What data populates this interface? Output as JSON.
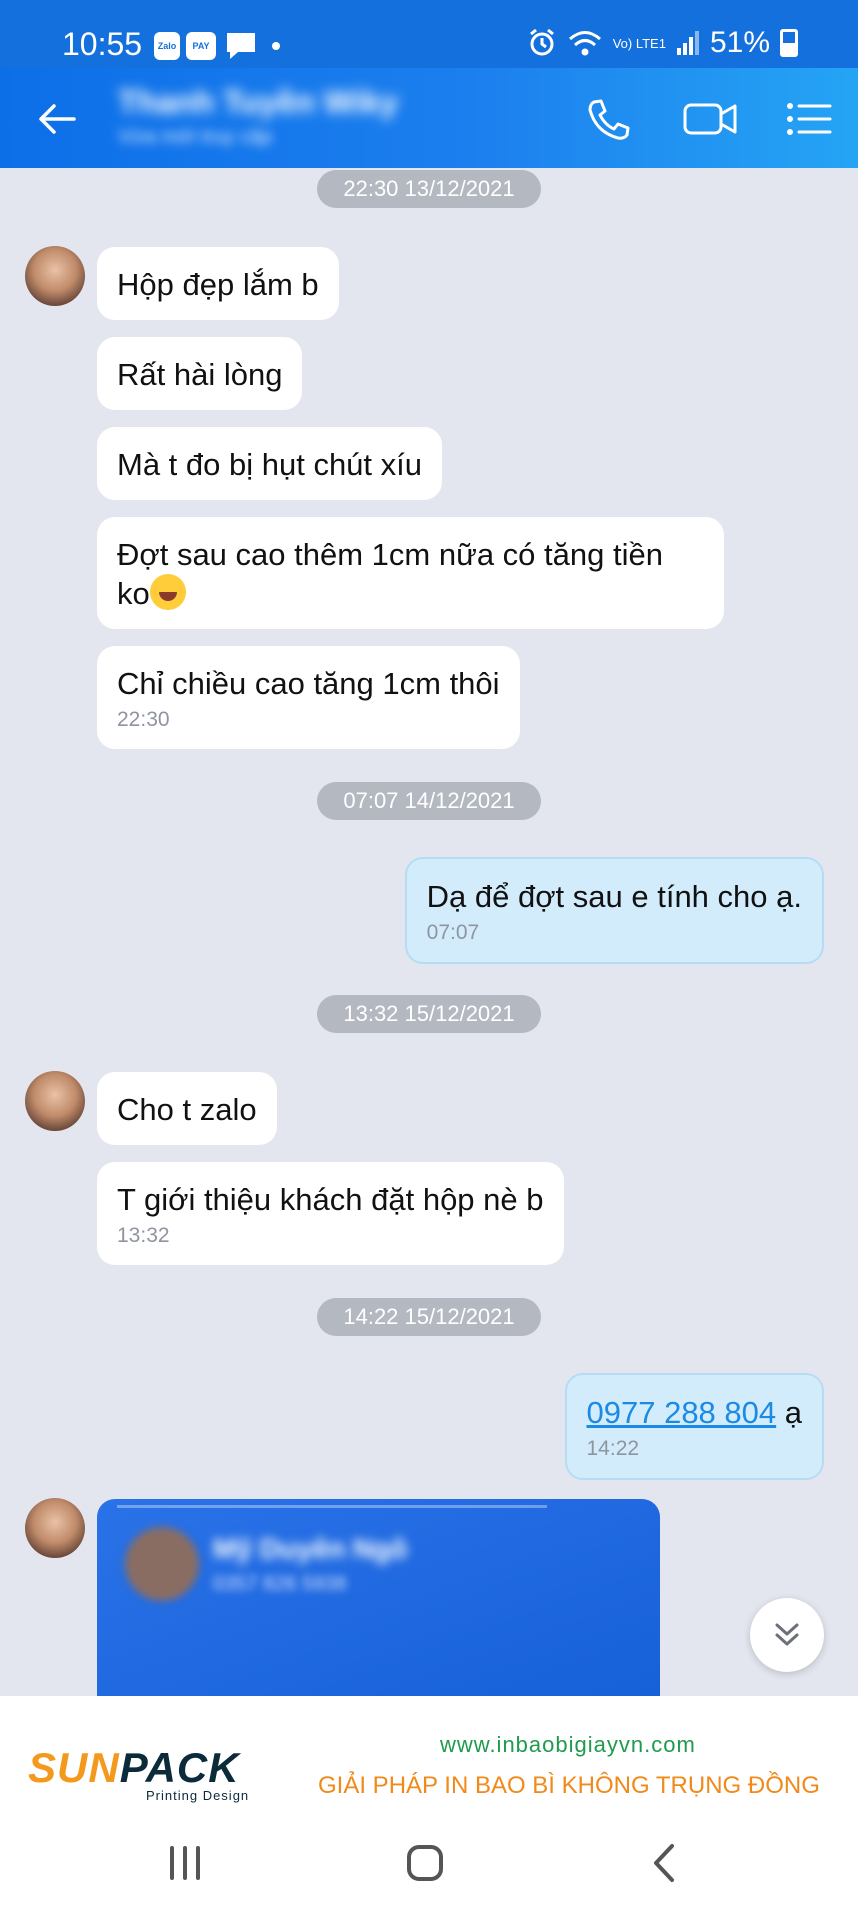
{
  "status_bar": {
    "time": "10:55",
    "apps": [
      "Zalo",
      "ZaloPay"
    ],
    "network_label": "Vo) LTE1",
    "battery": "51%"
  },
  "header": {
    "contact_name": "Thanh Tuyền Wiky",
    "contact_status": "Vừa mới truy cập",
    "icons": [
      "back-arrow-icon",
      "phone-icon",
      "video-call-icon",
      "menu-list-icon"
    ]
  },
  "messages": {
    "date_1": "22:30 13/12/2021",
    "m1": "Hộp đẹp lắm b",
    "m2": "Rất hài lòng",
    "m3": "Mà t đo bị hụt chút xíu",
    "m4_line1": "Đợt sau cao thêm 1cm nữa có tăng tiền",
    "m4_line2": "ko",
    "m5": "Chỉ chiều cao tăng 1cm thôi",
    "m5_time": "22:30",
    "date_2": "07:07 14/12/2021",
    "m6": "Dạ để đợt sau e tính cho ạ.",
    "m6_time": "07:07",
    "date_3": "13:32 15/12/2021",
    "m7": "Cho t zalo",
    "m8": "T giới thiệu khách đặt hộp nè b",
    "m8_time": "13:32",
    "date_4": "14:22 15/12/2021",
    "m9_phone": "0977 288 804",
    "m9_suffix": " ạ",
    "m9_time": "14:22",
    "card_name": "Mỹ Duyên Ngô",
    "card_phone": "0357 826 5938"
  },
  "banner": {
    "logo_sun": "SUN",
    "logo_pack": "PACK",
    "logo_sub": "Printing Design",
    "url": "www.inbaobigiayvn.com",
    "tagline": "GIẢI PHÁP IN BAO BÌ KHÔNG TRỤNG ĐỒNG"
  },
  "colors": {
    "header_blue": "#0d6fe8",
    "incoming_bubble": "#ffffff",
    "outgoing_bubble": "#d3ecfc",
    "chat_bg": "#e3e6ef",
    "link": "#1a8ae5"
  }
}
